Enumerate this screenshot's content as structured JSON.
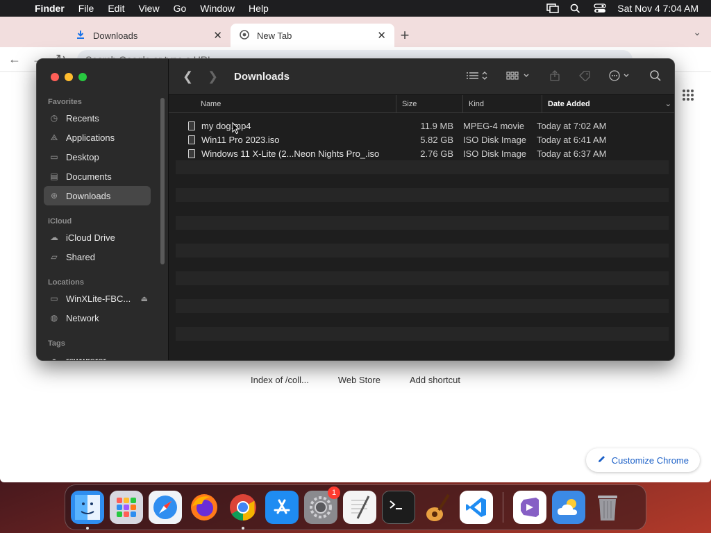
{
  "menubar": {
    "app_name": "Finder",
    "items": [
      "File",
      "Edit",
      "View",
      "Go",
      "Window",
      "Help"
    ],
    "datetime": "Sat Nov 4  7:04 AM"
  },
  "chrome": {
    "tabs": [
      {
        "title": "Downloads",
        "icon": "download-icon"
      },
      {
        "title": "New Tab",
        "icon": "chrome-icon"
      }
    ],
    "omnibox_placeholder": "Search Google or type a URL",
    "shortcuts": [
      "Index of /coll...",
      "Web Store",
      "Add shortcut"
    ],
    "customize_label": "Customize Chrome"
  },
  "finder": {
    "title": "Downloads",
    "sidebar": {
      "favorites_label": "Favorites",
      "favorites": [
        {
          "label": "Recents",
          "icon": "clock-icon"
        },
        {
          "label": "Applications",
          "icon": "applications-icon"
        },
        {
          "label": "Desktop",
          "icon": "desktop-icon"
        },
        {
          "label": "Documents",
          "icon": "document-icon"
        },
        {
          "label": "Downloads",
          "icon": "download-icon",
          "selected": true
        }
      ],
      "icloud_label": "iCloud",
      "icloud": [
        {
          "label": "iCloud Drive",
          "icon": "cloud-icon"
        },
        {
          "label": "Shared",
          "icon": "shared-folder-icon"
        }
      ],
      "locations_label": "Locations",
      "locations": [
        {
          "label": "WinXLite-FBC...",
          "icon": "drive-icon"
        },
        {
          "label": "Network",
          "icon": "network-icon"
        }
      ],
      "tags_label": "Tags",
      "tags": [
        {
          "label": "rewwrerer"
        }
      ]
    },
    "columns": {
      "name": "Name",
      "size": "Size",
      "kind": "Kind",
      "date": "Date Added"
    },
    "files": [
      {
        "name": "my dog.mp4",
        "size": "11.9 MB",
        "kind": "MPEG-4 movie",
        "date": "Today at 7:02 AM"
      },
      {
        "name": "Win11 Pro 2023.iso",
        "size": "5.82 GB",
        "kind": "ISO Disk Image",
        "date": "Today at 6:41 AM"
      },
      {
        "name": "Windows 11 X-Lite (2...Neon Nights Pro_.iso",
        "size": "2.76 GB",
        "kind": "ISO Disk Image",
        "date": "Today at 6:37 AM"
      }
    ]
  },
  "dock": {
    "apps": [
      {
        "name": "finder-app-icon",
        "color": "#2f8ef0",
        "running": true
      },
      {
        "name": "launchpad-app-icon",
        "color": "#d8d8e0",
        "running": false
      },
      {
        "name": "safari-app-icon",
        "color": "#f0f4f8",
        "running": false
      },
      {
        "name": "firefox-app-icon",
        "color": "#ff7a1a",
        "running": false
      },
      {
        "name": "chrome-app-icon",
        "color": "#ffffff",
        "running": true
      },
      {
        "name": "app-store-app-icon",
        "color": "#1f8cf2",
        "running": false
      },
      {
        "name": "system-settings-app-icon",
        "color": "#8a8a8e",
        "running": false,
        "badge": "1"
      },
      {
        "name": "textedit-app-icon",
        "color": "#f4f4f4",
        "running": false
      },
      {
        "name": "terminal-app-icon",
        "color": "#1c1c1c",
        "running": false
      },
      {
        "name": "garageband-app-icon",
        "color": "#e8a040",
        "running": false
      },
      {
        "name": "vscode-app-icon",
        "color": "#ffffff",
        "running": false
      },
      {
        "name": "visual-studio-app-icon",
        "color": "#ffffff",
        "running": false
      },
      {
        "name": "weather-app-icon",
        "color": "#3b8ae6",
        "running": false
      },
      {
        "name": "trash-icon",
        "color": "#9a9aa0",
        "running": false
      }
    ]
  }
}
